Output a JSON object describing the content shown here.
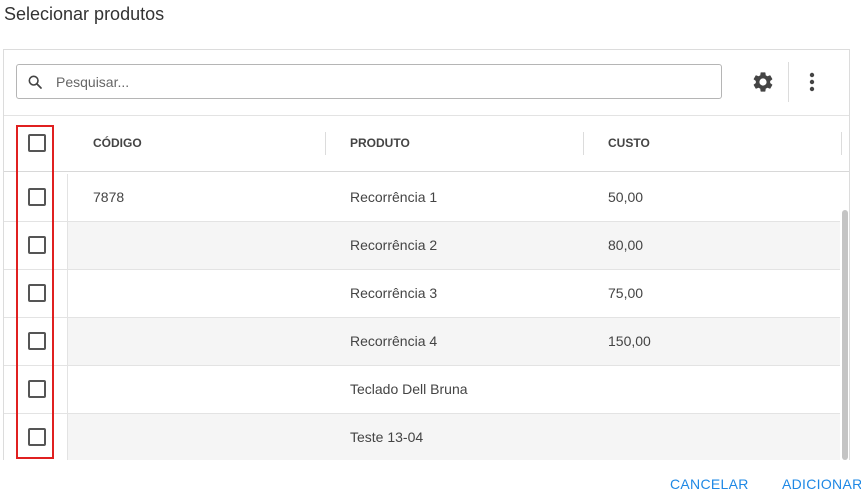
{
  "dialog": {
    "title": "Selecionar produtos"
  },
  "search": {
    "placeholder": "Pesquisar...",
    "value": ""
  },
  "toolbar": {
    "settings_icon": "gear-icon",
    "more_icon": "more-vert-icon"
  },
  "table": {
    "columns": {
      "code": "CÓDIGO",
      "product": "PRODUTO",
      "cost": "CUSTO"
    },
    "rows": [
      {
        "code": "7878",
        "product": "Recorrência 1",
        "cost": "50,00"
      },
      {
        "code": "",
        "product": "Recorrência 2",
        "cost": "80,00"
      },
      {
        "code": "",
        "product": "Recorrência 3",
        "cost": "75,00"
      },
      {
        "code": "",
        "product": "Recorrência 4",
        "cost": "150,00"
      },
      {
        "code": "",
        "product": "Teclado Dell Bruna",
        "cost": ""
      },
      {
        "code": "",
        "product": "Teste 13-04",
        "cost": ""
      }
    ]
  },
  "footer": {
    "cancel_label": "CANCELAR",
    "add_label": "ADICIONAR"
  },
  "colors": {
    "accent": "#1e88e5",
    "highlight": "#e02020"
  }
}
